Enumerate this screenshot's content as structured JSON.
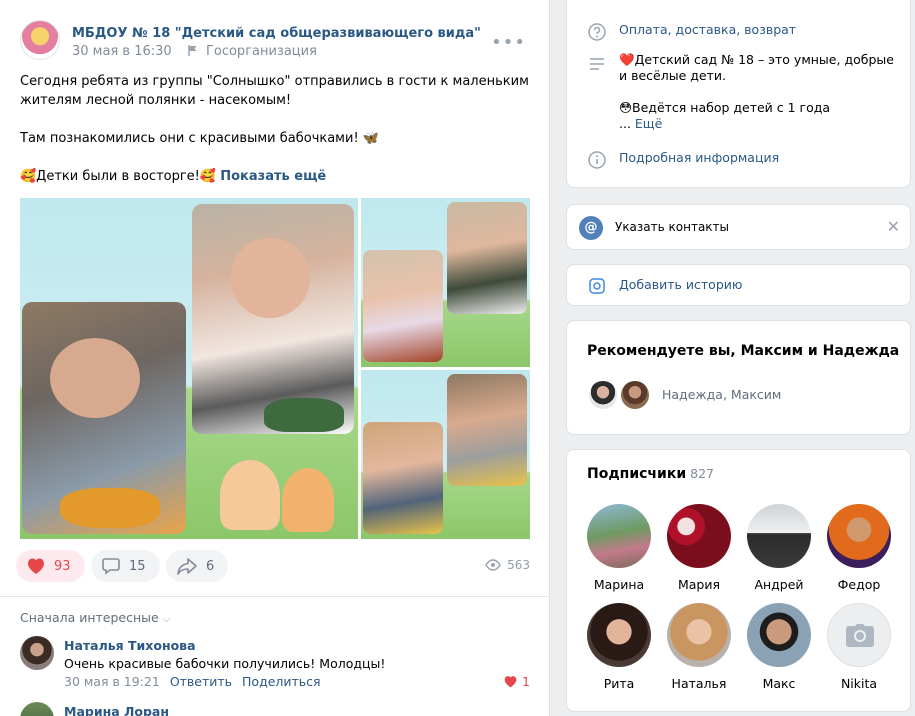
{
  "post": {
    "group_name": "МБДОУ № 18 \"Детский сад общеразвивающего вида\"",
    "date": "30 мая в 16:30",
    "org_type": "Госорганизация",
    "text_line1": "Сегодня ребята из группы \"Солнышко\" отправились в гости к маленьким жителям лесной полянки - насекомым!",
    "text_line2": "Там познакомились они с красивыми бабочками! 🦋",
    "text_line3": "🥰Детки были в восторге!🥰",
    "show_more": "Показать ещё",
    "likes": "93",
    "comments": "15",
    "shares": "6",
    "views": "563"
  },
  "comments": {
    "sort_label": "Сначала интересные",
    "items": [
      {
        "author": "Наталья Тихонова",
        "text": "Очень красивые бабочки получились! Молодцы!",
        "date": "30 мая в 19:21",
        "reply": "Ответить",
        "share": "Поделиться",
        "likes": "1"
      },
      {
        "author": "Марина Лоран"
      }
    ]
  },
  "sidebar": {
    "payment_link": "Оплата, доставка, возврат",
    "description_line1": "❤️Детский сад № 18 – это умные, добрые и весёлые дети.",
    "description_line2": "😳Ведётся набор детей с 1 года",
    "description_more_prefix": "... ",
    "description_more": "Ещё",
    "details_link": "Подробная информация",
    "contacts_label": "Указать контакты",
    "story_label": "Добавить историю",
    "recommend_title": "Рекомендуете вы, Максим и Надежда",
    "recommend_names": "Надежда, Максим",
    "subscribers_title": "Подписчики",
    "subscribers_count": "827",
    "subscribers": [
      {
        "name": "Марина"
      },
      {
        "name": "Мария"
      },
      {
        "name": "Андрей"
      },
      {
        "name": "Федор"
      },
      {
        "name": "Рита"
      },
      {
        "name": "Наталья"
      },
      {
        "name": "Макс"
      },
      {
        "name": "Nikita"
      }
    ]
  },
  "colors": {
    "link": "#2a5885",
    "like": "#e64646",
    "background": "#edeef0"
  }
}
